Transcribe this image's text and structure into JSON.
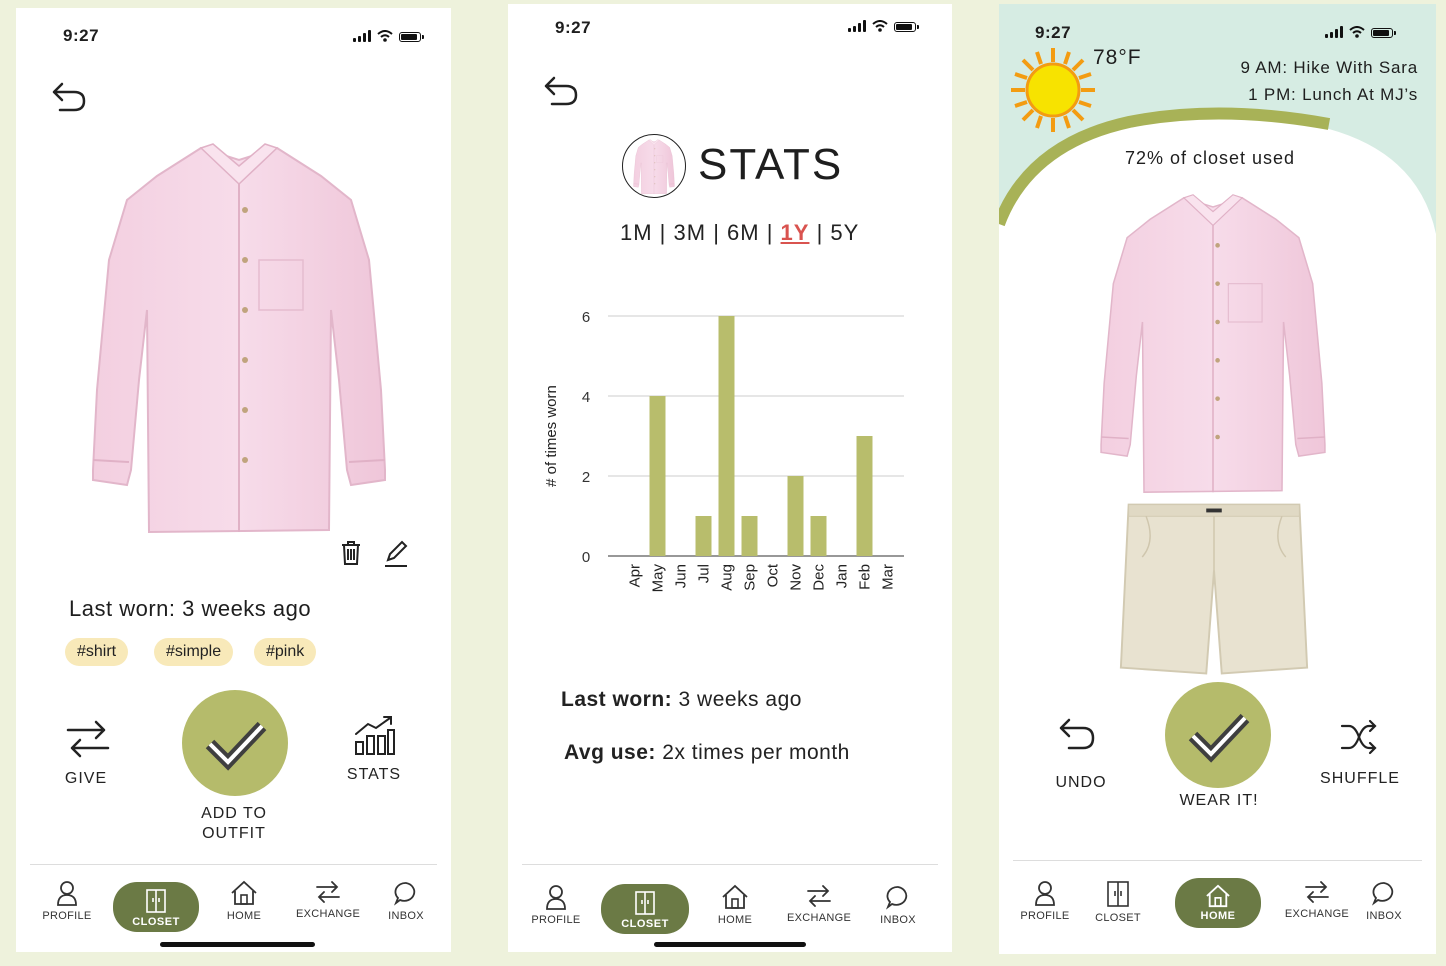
{
  "colors": {
    "accent_olive": "#6b7a45",
    "check_green": "#b5bb6b",
    "bar_color": "#b8bd6c",
    "tag_bg": "#f8e9b9",
    "selected_range": "#d9534f",
    "sky": "#d6ece3"
  },
  "screen_item": {
    "time": "9:27",
    "last_worn": "Last worn: 3 weeks ago",
    "tags": [
      "#shirt",
      "#simple",
      "#pink"
    ],
    "actions": {
      "give": "GIVE",
      "add_to_outfit_line1": "ADD TO",
      "add_to_outfit_line2": "OUTFIT",
      "stats": "STATS"
    },
    "nav": {
      "profile": "PROFILE",
      "closet": "CLOSET",
      "home": "HOME",
      "exchange": "EXCHANGE",
      "inbox": "INBOX",
      "active": "closet"
    }
  },
  "screen_stats": {
    "time": "9:27",
    "title": "STATS",
    "ranges": [
      "1M",
      "3M",
      "6M",
      "1Y",
      "5Y"
    ],
    "selected_range": "1Y",
    "last_worn_label": "Last worn:",
    "last_worn_value": "3 weeks ago",
    "avg_use_label": "Avg use:",
    "avg_use_value": "2x times per month",
    "nav": {
      "profile": "PROFILE",
      "closet": "CLOSET",
      "home": "HOME",
      "exchange": "EXCHANGE",
      "inbox": "INBOX",
      "active": "closet"
    }
  },
  "chart_data": {
    "type": "bar",
    "categories": [
      "Apr",
      "May",
      "Jun",
      "Jul",
      "Aug",
      "Sep",
      "Oct",
      "Nov",
      "Dec",
      "Jan",
      "Feb",
      "Mar"
    ],
    "values": [
      0,
      4,
      0,
      1,
      6,
      1,
      0,
      2,
      1,
      0,
      3,
      0
    ],
    "ylabel": "# of times worn",
    "xlabel": "",
    "ylim": [
      0,
      6
    ],
    "yticks": [
      0,
      2,
      4,
      6
    ],
    "grid": true
  },
  "screen_home": {
    "time": "9:27",
    "temperature": "78°F",
    "events": [
      "9 AM: Hike With Sara",
      "1 PM: Lunch At MJ’s"
    ],
    "closet_used": "72% of closet used",
    "actions": {
      "undo": "UNDO",
      "wear_it": "WEAR IT!",
      "shuffle": "SHUFFLE"
    },
    "nav": {
      "profile": "PROFILE",
      "closet": "CLOSET",
      "home": "HOME",
      "exchange": "EXCHANGE",
      "inbox": "INBOX",
      "active": "home"
    }
  }
}
